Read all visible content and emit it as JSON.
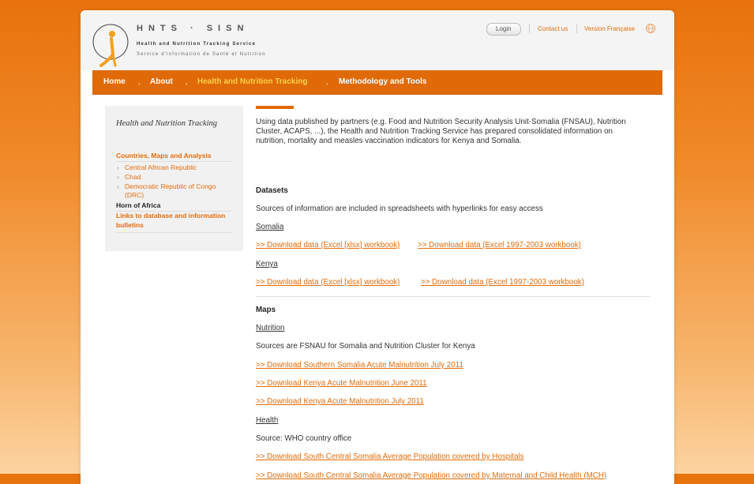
{
  "header": {
    "brand_title": "HNTS · SISN",
    "brand_subtitle_en": "Health and Nutrition Tracking Service",
    "brand_subtitle_fr": "Service d'information de Santé et Nutrition",
    "login_label": "Login",
    "contact_label": "Contact us",
    "language_label": "Version Française"
  },
  "nav": {
    "items": [
      {
        "label": "Home"
      },
      {
        "label": "About"
      },
      {
        "label": "Health and Nutrition Tracking"
      },
      {
        "label": "Methodology and Tools"
      }
    ]
  },
  "sidebar": {
    "title": "Health and Nutrition Tracking",
    "section_label": "Countries, Maps and Analysis",
    "items": [
      {
        "label": "Central African Republic"
      },
      {
        "label": "Chad"
      },
      {
        "label": "Democratic Republic of Congo (DRC)"
      }
    ],
    "current": "Horn of Africa",
    "links_label": "Links to database and information bulletins"
  },
  "content": {
    "intro": "Using data published by partners (e.g. Food and Nutrition Security Analysis Unit-Somalia (FNSAU), Nutrition Cluster, ACAPS, ...), the Health and Nutrition Tracking Service has prepared consolidated information on nutrition, mortality and measles vaccination indicators for Kenya and Somalia.",
    "datasets_heading": "Datasets",
    "datasets_text": "Sources of information are included in spreadsheets with hyperlinks for easy access",
    "somalia_label": "Somalia",
    "somalia_links": [
      ">> Download data (Excel [xlsx] workbook)",
      ">> Download data (Excel 1997-2003 workbook)"
    ],
    "kenya_label": "Kenya",
    "kenya_links": [
      ">> Download data (Excel [xlsx] workbook)",
      ">> Download data (Excel 1997-2003 workbook)"
    ],
    "maps_heading": "Maps",
    "nutrition_label": "Nutrition",
    "nutrition_text": "Sources are FSNAU for Somalia and Nutrition Cluster for Kenya",
    "nutrition_links": [
      ">> Download Southern Somalia Acute Malnutrition July 2011",
      ">> Download Kenya Acute Malnutrition June 2011",
      ">> Download Kenya Acute Malnutrition July 2011"
    ],
    "health_label": "Health",
    "health_text": "Source: WHO country office",
    "health_links": [
      ">> Download South Central Somalia Average Population covered by Hospitals",
      ">> Download South Central Somalia Average Population covered by Maternal and Child Health (MCH)"
    ]
  },
  "colors": {
    "accent": "#e06a08",
    "link": "#e36c0a",
    "nav_active": "#ffd04d"
  }
}
